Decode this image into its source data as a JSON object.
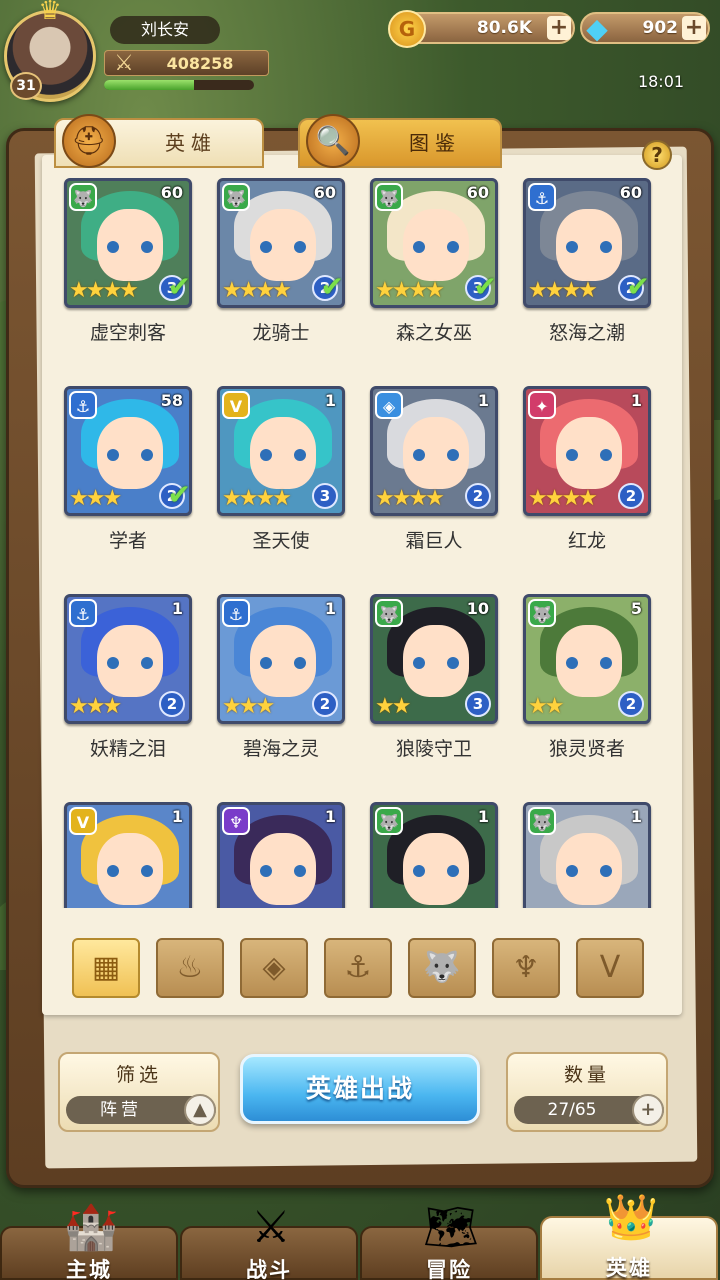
{
  "player": {
    "name": "刘长安",
    "level": "31",
    "power": "408258",
    "xp_fraction": 0.6
  },
  "currency": {
    "gold": "80.6K",
    "gems": "902"
  },
  "clock": "18:01",
  "tabs": [
    {
      "label": "英雄"
    },
    {
      "label": "图鉴"
    }
  ],
  "help_label": "?",
  "heroes": [
    {
      "name": "虚空刺客",
      "level": "60",
      "stars": "★★★★",
      "rank": "3",
      "faction": "beast",
      "equipped": true,
      "hair": "#3fae85",
      "bg": "#4f7f5a"
    },
    {
      "name": "龙骑士",
      "level": "60",
      "stars": "★★★★",
      "rank": "2",
      "faction": "beast",
      "equipped": true,
      "hair": "#dcdcdc",
      "bg": "#6b87a8"
    },
    {
      "name": "森之女巫",
      "level": "60",
      "stars": "★★★★",
      "rank": "3",
      "faction": "beast",
      "equipped": true,
      "hair": "#f3e6c8",
      "bg": "#7fa46a"
    },
    {
      "name": "怒海之潮",
      "level": "60",
      "stars": "★★★★",
      "rank": "2",
      "faction": "sea",
      "equipped": true,
      "hair": "#7d8796",
      "bg": "#5a6b86"
    },
    {
      "name": "学者",
      "level": "58",
      "stars": "★★★",
      "rank": "2",
      "faction": "sea",
      "equipped": true,
      "hair": "#2fb8e8",
      "bg": "#4a7fc9"
    },
    {
      "name": "圣天使",
      "level": "1",
      "stars": "★★★★",
      "rank": "3",
      "faction": "light",
      "equipped": false,
      "hair": "#36c4c9",
      "bg": "#4f97c0"
    },
    {
      "name": "霜巨人",
      "level": "1",
      "stars": "★★★★",
      "rank": "2",
      "faction": "ice",
      "equipped": false,
      "hair": "#d9dade",
      "bg": "#6b7a90"
    },
    {
      "name": "红龙",
      "level": "1",
      "stars": "★★★★",
      "rank": "2",
      "faction": "fire",
      "equipped": false,
      "hair": "#ec6b70",
      "bg": "#b84a5b"
    },
    {
      "name": "妖精之泪",
      "level": "1",
      "stars": "★★★",
      "rank": "2",
      "faction": "sea",
      "equipped": false,
      "hair": "#3b62d8",
      "bg": "#5574c4"
    },
    {
      "name": "碧海之灵",
      "level": "1",
      "stars": "★★★",
      "rank": "2",
      "faction": "sea",
      "equipped": false,
      "hair": "#4a86d6",
      "bg": "#6b9ad6"
    },
    {
      "name": "狼陵守卫",
      "level": "10",
      "stars": "★★",
      "rank": "3",
      "faction": "beast",
      "equipped": false,
      "hair": "#1f1f26",
      "bg": "#3d6b4a"
    },
    {
      "name": "狼灵贤者",
      "level": "5",
      "stars": "★★",
      "rank": "2",
      "faction": "beast",
      "equipped": false,
      "hair": "#4d7a3a",
      "bg": "#8cb06a"
    },
    {
      "name": "",
      "level": "1",
      "stars": "",
      "rank": "",
      "faction": "light",
      "equipped": false,
      "hair": "#f0c23e",
      "bg": "#5a86c9"
    },
    {
      "name": "",
      "level": "1",
      "stars": "",
      "rank": "",
      "faction": "dark",
      "equipped": false,
      "hair": "#3a2a5a",
      "bg": "#4a5aa4"
    },
    {
      "name": "",
      "level": "1",
      "stars": "",
      "rank": "",
      "faction": "beast",
      "equipped": false,
      "hair": "#1f1f26",
      "bg": "#3d6b4a"
    },
    {
      "name": "",
      "level": "1",
      "stars": "",
      "rank": "",
      "faction": "beast",
      "equipped": false,
      "hair": "#c8c8c8",
      "bg": "#9aa7ba"
    }
  ],
  "faction_icons": {
    "beast": "🐺",
    "sea": "⚓",
    "light": "V",
    "ice": "◈",
    "fire": "✦",
    "dark": "♆"
  },
  "faction_colors": {
    "beast": "#3aa94a",
    "sea": "#2f6fd0",
    "light": "#e3b31c",
    "ice": "#3a8fe0",
    "fire": "#d23c6a",
    "dark": "#7a3cc9"
  },
  "filters": [
    {
      "name": "all",
      "icon": "▦"
    },
    {
      "name": "fire",
      "icon": "♨"
    },
    {
      "name": "ice",
      "icon": "◈"
    },
    {
      "name": "sea",
      "icon": "⚓"
    },
    {
      "name": "beast",
      "icon": "🐺"
    },
    {
      "name": "dark",
      "icon": "♆"
    },
    {
      "name": "light",
      "icon": "V"
    }
  ],
  "controls": {
    "filter_title": "筛选",
    "filter_value": "阵营",
    "deploy": "英雄出战",
    "count_title": "数量",
    "count_value": "27/65"
  },
  "nav": [
    {
      "label": "主城",
      "icon": "🏰"
    },
    {
      "label": "战斗",
      "icon": "⚔"
    },
    {
      "label": "冒险",
      "icon": "🗺"
    },
    {
      "label": "英雄",
      "icon": "👑"
    }
  ]
}
